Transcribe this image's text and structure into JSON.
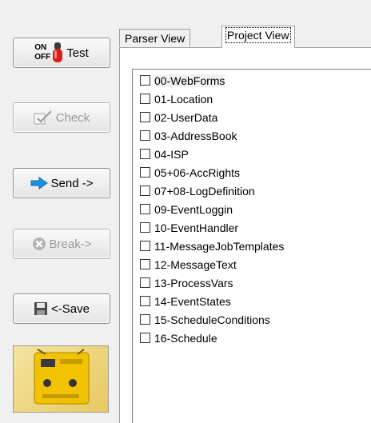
{
  "toolbar": {
    "test": {
      "on": "ON",
      "off": "OFF",
      "label": "Test"
    },
    "check": {
      "label": "Check"
    },
    "send": {
      "label": "Send ->"
    },
    "break": {
      "label": "Break->"
    },
    "save": {
      "label": "<-Save"
    }
  },
  "tabs": [
    {
      "label": "Parser View",
      "active": false
    },
    {
      "label": "Project View",
      "active": true
    }
  ],
  "project_list": {
    "items": [
      {
        "label": "00-WebForms",
        "checked": false
      },
      {
        "label": "01-Location",
        "checked": false
      },
      {
        "label": "02-UserData",
        "checked": false
      },
      {
        "label": "03-AddressBook",
        "checked": false
      },
      {
        "label": "04-ISP",
        "checked": false
      },
      {
        "label": "05+06-AccRights",
        "checked": false
      },
      {
        "label": "07+08-LogDefinition",
        "checked": false
      },
      {
        "label": "09-EventLoggin",
        "checked": false
      },
      {
        "label": "10-EventHandler",
        "checked": false
      },
      {
        "label": "11-MessageJobTemplates",
        "checked": false
      },
      {
        "label": "12-MessageText",
        "checked": false
      },
      {
        "label": "13-ProcessVars",
        "checked": false
      },
      {
        "label": "14-EventStates",
        "checked": false
      },
      {
        "label": "15-ScheduleConditions",
        "checked": false
      },
      {
        "label": "16-Schedule",
        "checked": false
      }
    ]
  },
  "colors": {
    "send_arrow": "#1e8fe0",
    "switch_red": "#d91e18",
    "device_yellow": "#f2c200"
  },
  "icons": {
    "test": "on-off-switch-icon",
    "check": "check-icon",
    "send": "send-arrow-icon",
    "break": "break-icon",
    "save": "floppy-disk-icon",
    "thumbnail": "device-thumbnail"
  }
}
